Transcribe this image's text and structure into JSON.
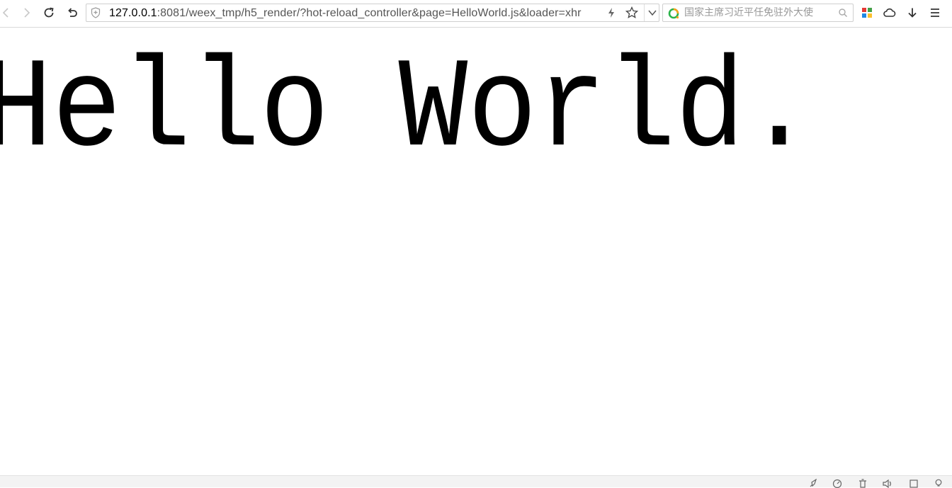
{
  "browser": {
    "address_bar": {
      "url_host": "127.0.0.1",
      "url_rest": ":8081/weex_tmp/h5_render/?hot-reload_controller&page=HelloWorld.js&loader=xhr"
    },
    "search_box": {
      "placeholder": "国家主席习近平任免驻外大使"
    },
    "toolbar_icons": [
      "back-icon",
      "forward-icon",
      "reload-icon",
      "undo-icon",
      "shield-icon",
      "lightning-icon",
      "star-icon",
      "chevron-down-icon",
      "search-engine-icon",
      "search-icon",
      "apps-icon",
      "cloud-icon",
      "download-icon",
      "menu-icon"
    ],
    "status_icons": [
      "rocket-icon",
      "speed-icon",
      "trash-icon",
      "sound-icon",
      "window-icon",
      "bulb-icon"
    ]
  },
  "page": {
    "heading": "Hello World."
  },
  "colors": {
    "page_background": "#ffffff",
    "text": "#000000",
    "engine_green": "#2bb34a",
    "engine_orange": "#f7a21b"
  }
}
